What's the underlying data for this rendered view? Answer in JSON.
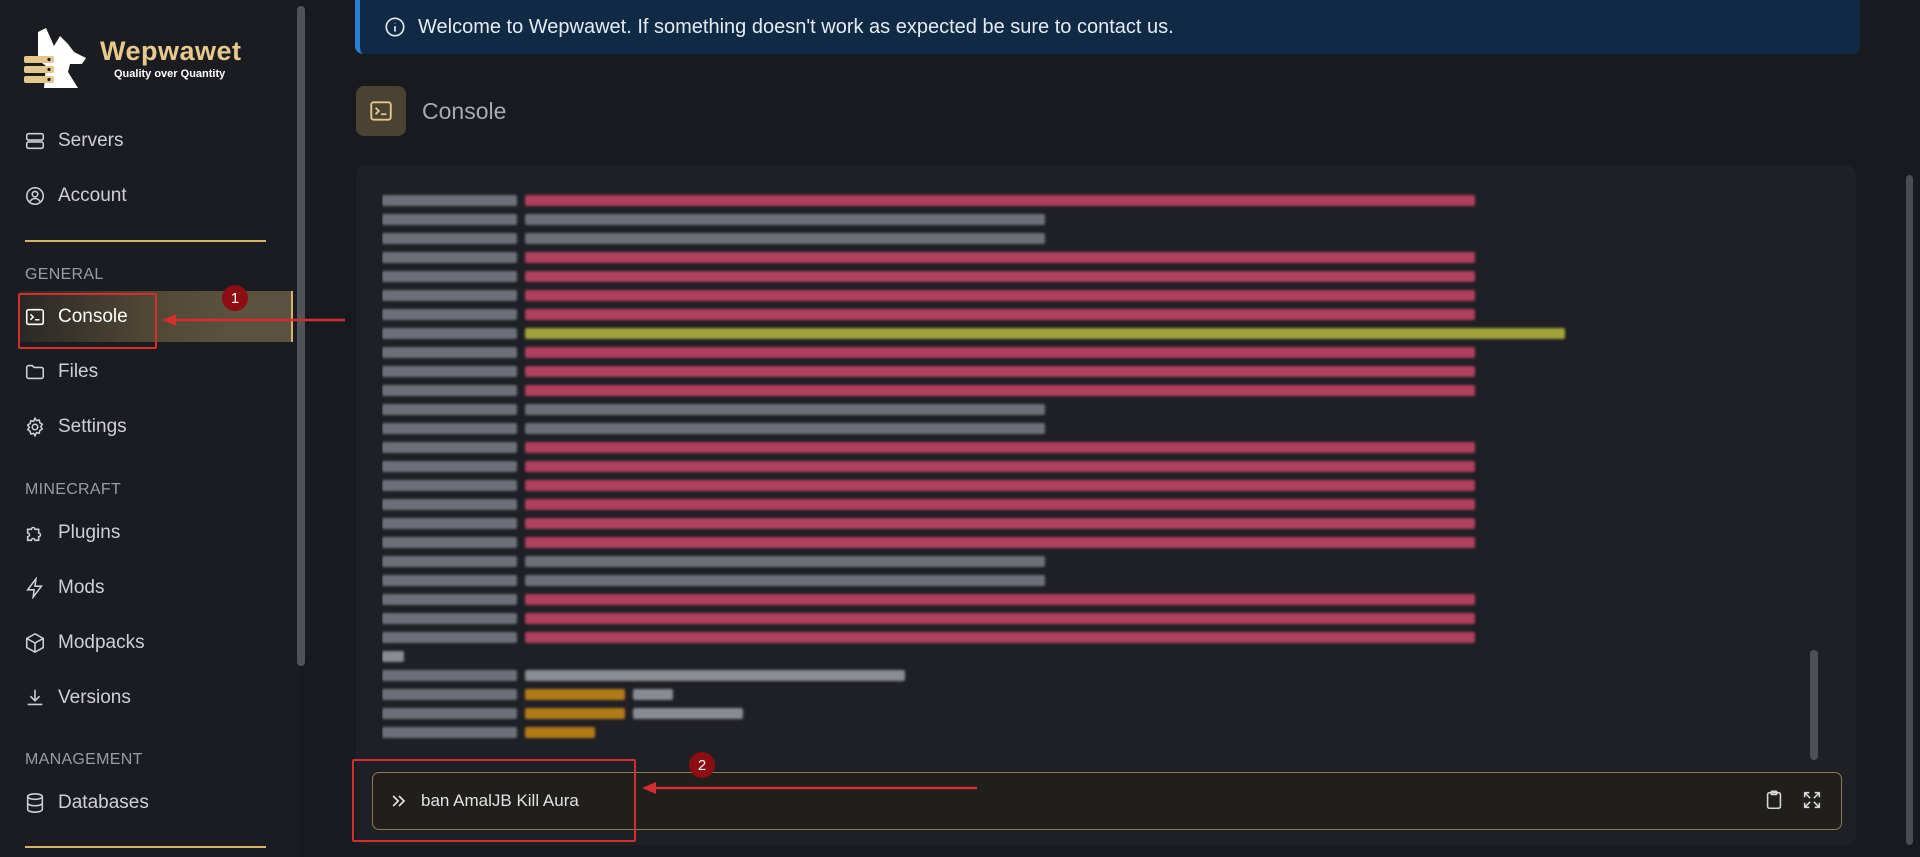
{
  "brand": {
    "name": "Wepwawet",
    "tagline": "Quality over Quantity"
  },
  "sidebar": {
    "top_items": [
      {
        "label": "Servers",
        "icon": "server-icon"
      },
      {
        "label": "Account",
        "icon": "user-circle-icon"
      }
    ],
    "sections": [
      {
        "title": "GENERAL",
        "items": [
          {
            "label": "Console",
            "icon": "terminal-icon",
            "active": true
          },
          {
            "label": "Files",
            "icon": "folder-icon"
          },
          {
            "label": "Settings",
            "icon": "gear-icon"
          }
        ]
      },
      {
        "title": "MINECRAFT",
        "items": [
          {
            "label": "Plugins",
            "icon": "puzzle-icon"
          },
          {
            "label": "Mods",
            "icon": "lightning-icon"
          },
          {
            "label": "Modpacks",
            "icon": "cube-icon"
          },
          {
            "label": "Versions",
            "icon": "download-icon"
          }
        ]
      },
      {
        "title": "MANAGEMENT",
        "items": [
          {
            "label": "Databases",
            "icon": "database-icon"
          }
        ]
      }
    ]
  },
  "banner": {
    "text": "Welcome to Wepwawet. If something doesn't work as expected be sure to contact us."
  },
  "page": {
    "title": "Console"
  },
  "console": {
    "command_value": "ban AmalJB Kill Aura",
    "tools": [
      "clipboard-icon",
      "expand-icon"
    ]
  },
  "annotations": [
    {
      "number": "1",
      "target": "Console"
    },
    {
      "number": "2",
      "target": "command input"
    }
  ],
  "colors": {
    "accent": "#d9b26a",
    "banner_bg": "#102a45",
    "banner_border": "#2a7fd6",
    "annotation": "#d32f2f"
  }
}
